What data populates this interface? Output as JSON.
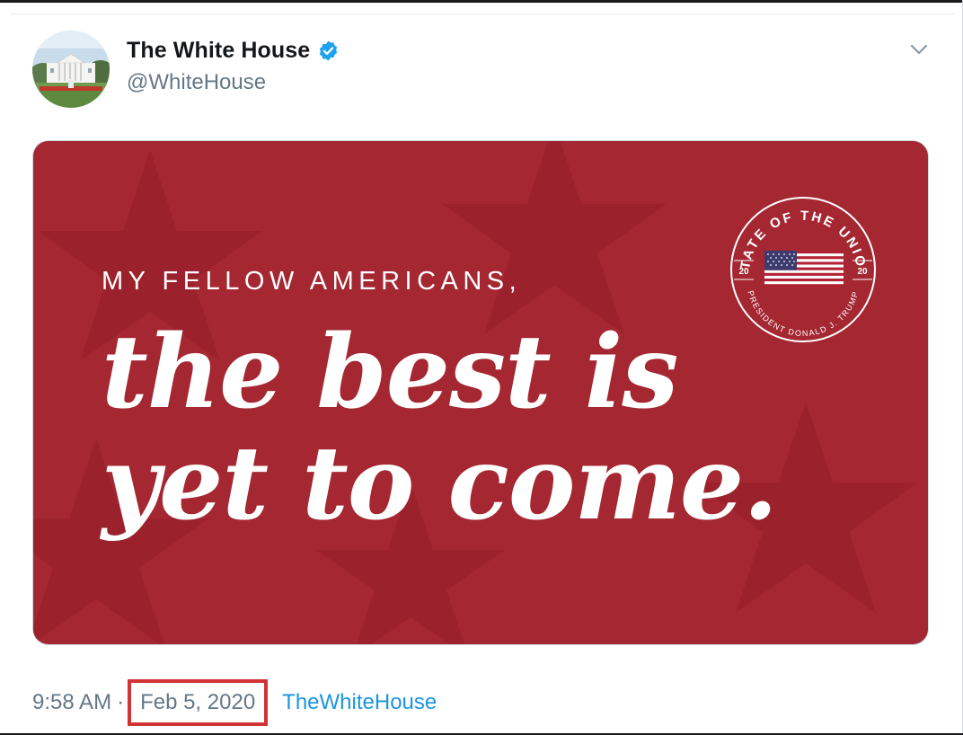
{
  "tweet": {
    "display_name": "The White House",
    "handle": "@WhiteHouse",
    "verified": true,
    "time": "9:58 AM",
    "separator": "·",
    "date": "Feb 5, 2020",
    "source": "TheWhiteHouse"
  },
  "media": {
    "kicker": "MY FELLOW AMERICANS,",
    "headline_line1": "the best is",
    "headline_line2": "yet to come.",
    "seal": {
      "top_text": "STATE OF THE UNION",
      "bottom_text": "PRESIDENT DONALD J. TRUMP",
      "year_left": "20",
      "year_right": "20"
    }
  },
  "colors": {
    "media_background": "#a42731",
    "accent": "#1b95e0",
    "highlight_box": "#d03434",
    "verified_badge": "#1da1f2"
  },
  "icons": {
    "verified": "verified-badge-icon",
    "caret": "chevron-down-icon",
    "flag": "us-flag-icon"
  }
}
